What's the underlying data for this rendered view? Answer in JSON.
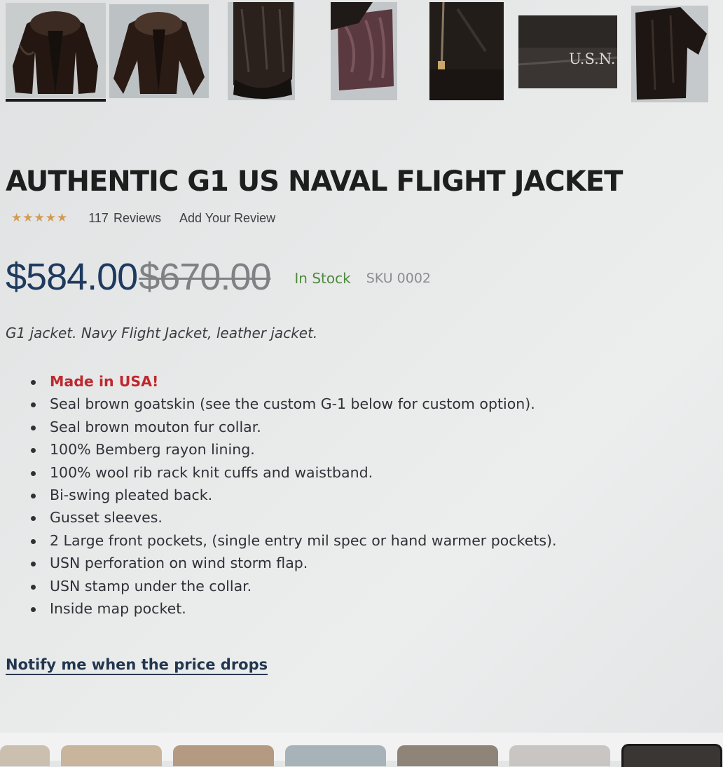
{
  "gallery": {
    "thumbnails": [
      {
        "name": "front-view"
      },
      {
        "name": "angled-view"
      },
      {
        "name": "sleeve-detail"
      },
      {
        "name": "lining-detail"
      },
      {
        "name": "zipper-detail"
      },
      {
        "name": "usn-stamp-detail",
        "label": "U.S.N."
      },
      {
        "name": "back-view"
      }
    ],
    "active_index": 0
  },
  "product": {
    "title": "AUTHENTIC G1 US NAVAL FLIGHT JACKET",
    "rating": 5,
    "review_count": "117",
    "reviews_label": "Reviews",
    "add_review": "Add Your Review",
    "price": "$584.00",
    "old_price": "$670.00",
    "stock_status": "In Stock",
    "sku": "SKU 0002",
    "short_description": "G1 jacket. Navy Flight Jacket, leather jacket.",
    "features": [
      "Made in USA!",
      "Seal brown goatskin (see the custom G-1 below for custom option).",
      "Seal brown mouton fur collar.",
      "100% Bemberg rayon lining.",
      "100% wool rib rack knit cuffs and waistband.",
      "Bi-swing pleated back.",
      "Gusset sleeves.",
      "2 Large front pockets, (single entry mil spec or hand warmer pockets).",
      "USN perforation on wind storm flap.",
      "USN stamp under the collar.",
      "Inside map pocket."
    ],
    "notify_link": "Notify me when the price drops"
  },
  "colors": {
    "price": "#1e3a5f",
    "old_price": "#7f8285",
    "in_stock": "#4d8a3b",
    "highlight_feature": "#c0282e",
    "star": "#d39b52"
  }
}
